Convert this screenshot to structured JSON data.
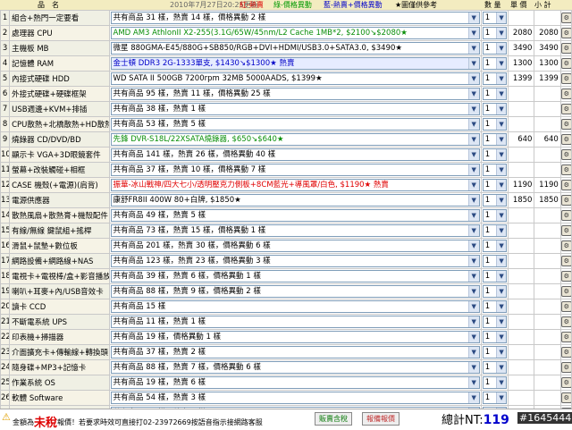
{
  "header": {
    "name_label": "品　名",
    "updated": "2010年7月27日20:25更新",
    "legend_red": "紅-熱賣",
    "legend_green": "綠-價格異動",
    "legend_blue": "藍-熱賣+價格異動",
    "legend_note": "★圖僅供參考",
    "qty_label": "數 量",
    "price_label": "單 價",
    "subtotal_label": "小 計"
  },
  "rows": [
    {
      "num": "1",
      "cat": "組合+熱門一定要看",
      "item": "共有商品 31 樣，熱賣 14 樣，價格異動 2 樣",
      "hl": "",
      "qty": "1",
      "price": "",
      "sub": ""
    },
    {
      "num": "2",
      "cat": "處理器 CPU",
      "item": "AMD AM3 AthlonII X2-255(3.1G/65W/45nm/L2 Cache 1MB*2, $2100↘$2080★",
      "hl": "green",
      "qty": "1",
      "price": "2080",
      "sub": "2080"
    },
    {
      "num": "3",
      "cat": "主機板 MB",
      "item": "微星 880GMA-E45/880G+SB850/RGB+DVI+HDMI/USB3.0+SATA3.0, $3490★",
      "hl": "",
      "qty": "1",
      "price": "3490",
      "sub": "3490"
    },
    {
      "num": "4",
      "cat": "記憶體 RAM",
      "item": "金士頓 DDR3 2G-1333單支, $1430↘$1300★ 熱賣",
      "hl": "blue",
      "qty": "1",
      "price": "1300",
      "sub": "1300"
    },
    {
      "num": "5",
      "cat": "內接式硬碟 HDD",
      "item": "WD SATA II 500GB 7200rpm 32MB 5000AADS, $1399★",
      "hl": "",
      "qty": "1",
      "price": "1399",
      "sub": "1399"
    },
    {
      "num": "6",
      "cat": "外接式硬碟+硬碟框架",
      "item": "共有商品 95 樣，熱賣 11 樣，價格異動 25 樣",
      "hl": "",
      "qty": "1",
      "price": "",
      "sub": ""
    },
    {
      "num": "7",
      "cat": "USB週邊+KVM+排插",
      "item": "共有商品 38 樣，熱賣 1 樣",
      "hl": "",
      "qty": "1",
      "price": "",
      "sub": ""
    },
    {
      "num": "8",
      "cat": "CPU散熱+北橋散熱+HD散熱",
      "item": "共有商品 53 樣，熱賣 5 樣",
      "hl": "",
      "qty": "1",
      "price": "",
      "sub": ""
    },
    {
      "num": "9",
      "cat": "燒錄器 CD/DVD/BD",
      "item": "先鋒 DVR-S18L/22XSATA燒錄器, $650↘$640★",
      "hl": "green",
      "qty": "1",
      "price": "640",
      "sub": "640"
    },
    {
      "num": "10",
      "cat": "顯示卡 VGA+3D眼鏡套件",
      "item": "共有商品 141 樣，熱賣 26 樣，價格異動 40 樣",
      "hl": "",
      "qty": "1",
      "price": "",
      "sub": ""
    },
    {
      "num": "11",
      "cat": "螢幕+改裝觸碰+相框",
      "item": "共有商品 37 樣，熱賣 10 樣，價格異動 7 樣",
      "hl": "",
      "qty": "1",
      "price": "",
      "sub": ""
    },
    {
      "num": "12",
      "cat": "CASE 機殼(+電源)(肩背)",
      "item": "振華-冰山戰神/四大七小/透明壓克力側板+8CM藍光+導風罩/白色, $1190★ 熱賣",
      "hl": "red",
      "qty": "1",
      "price": "1190",
      "sub": "1190"
    },
    {
      "num": "13",
      "cat": "電源供應器",
      "item": "康舒FR8II 400W 80+白牌, $1850★",
      "hl": "",
      "qty": "1",
      "price": "1850",
      "sub": "1850"
    },
    {
      "num": "14",
      "cat": "散熱風扇+散熱膏+機殼配件",
      "item": "共有商品 49 樣，熱賣 5 樣",
      "hl": "",
      "qty": "1",
      "price": "",
      "sub": ""
    },
    {
      "num": "15",
      "cat": "有線/無線 鍵鼠組+搖桿",
      "item": "共有商品 73 樣，熱賣 15 樣，價格異動 1 樣",
      "hl": "",
      "qty": "1",
      "price": "",
      "sub": ""
    },
    {
      "num": "16",
      "cat": "滑鼠+鼠墊+數位板",
      "item": "共有商品 201 樣，熱賣 30 樣，價格異動 6 樣",
      "hl": "",
      "qty": "1",
      "price": "",
      "sub": ""
    },
    {
      "num": "17",
      "cat": "網路設備+網路線+NAS",
      "item": "共有商品 123 樣，熱賣 23 樣，價格異動 3 樣",
      "hl": "",
      "qty": "1",
      "price": "",
      "sub": ""
    },
    {
      "num": "18",
      "cat": "電視卡+電視棒/盒+影音播放",
      "item": "共有商品 39 樣，熱賣 6 樣，價格異動 1 樣",
      "hl": "",
      "qty": "1",
      "price": "",
      "sub": ""
    },
    {
      "num": "19",
      "cat": "喇叭+耳麥+內/USB音效卡",
      "item": "共有商品 88 樣，熱賣 9 樣，價格異動 2 樣",
      "hl": "",
      "qty": "1",
      "price": "",
      "sub": ""
    },
    {
      "num": "20",
      "cat": "讀卡 CCD",
      "item": "共有商品 15 樣",
      "hl": "",
      "qty": "1",
      "price": "",
      "sub": ""
    },
    {
      "num": "21",
      "cat": "不斷電系統 UPS",
      "item": "共有商品 11 樣，熱賣 1 樣",
      "hl": "",
      "qty": "1",
      "price": "",
      "sub": ""
    },
    {
      "num": "22",
      "cat": "印表機+掃描器",
      "item": "共有商品 19 樣，價格異動 1 樣",
      "hl": "",
      "qty": "1",
      "price": "",
      "sub": ""
    },
    {
      "num": "23",
      "cat": "介面擴充卡+傳輸線+轉換頭",
      "item": "共有商品 37 樣，熱賣 2 樣",
      "hl": "",
      "qty": "1",
      "price": "",
      "sub": ""
    },
    {
      "num": "24",
      "cat": "隨身碟+MP3+記憶卡",
      "item": "共有商品 88 樣，熱賣 7 樣，價格異動 6 樣",
      "hl": "",
      "qty": "1",
      "price": "",
      "sub": ""
    },
    {
      "num": "25",
      "cat": "作業系統 OS",
      "item": "共有商品 19 樣，熱賣 6 樣",
      "hl": "",
      "qty": "1",
      "price": "",
      "sub": ""
    },
    {
      "num": "26",
      "cat": "軟體 Software",
      "item": "共有商品 54 樣，熱賣 3 樣",
      "hl": "",
      "qty": "1",
      "price": "",
      "sub": ""
    },
    {
      "num": "27",
      "cat": "套裝電腦+準系統",
      "item": "共有商品 25 樣，熱賣 9 樣",
      "hl": "",
      "qty": "1",
      "price": "",
      "sub": ""
    }
  ],
  "footer": {
    "prefix": "金額為",
    "big": "未稅",
    "suffix": "報價！若要求時效可直接打02-23972669按語音指示接網路客服",
    "btn_tax": "販賣含稅",
    "btn_reset": "報備報價",
    "total_label": "總計NT:",
    "total_value": "119",
    "watermark": "#1645444"
  },
  "colors": {
    "red": "#d00000",
    "green": "#098e09",
    "blue": "#0000c8",
    "header_bg": "#f3ecc0"
  },
  "icons": {
    "row_action": "gear-icon",
    "dropdown": "chevron-down-icon",
    "warning": "warning-icon"
  }
}
